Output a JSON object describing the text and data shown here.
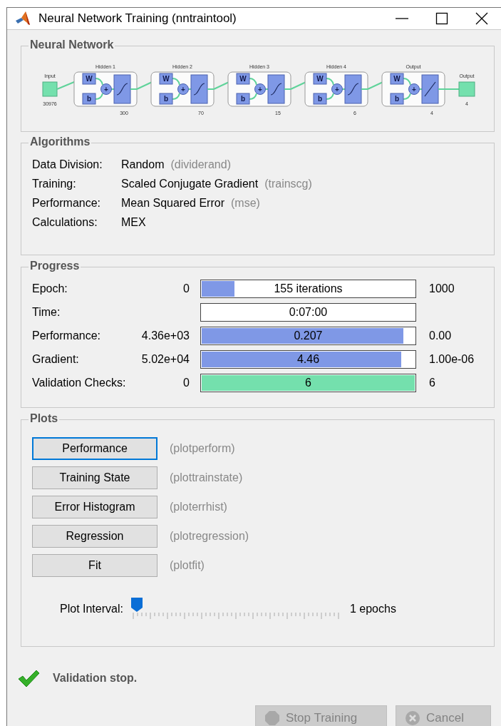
{
  "window": {
    "title": "Neural Network Training (nntraintool)"
  },
  "network": {
    "title": "Neural Network",
    "input": {
      "label": "Input",
      "size": "30976"
    },
    "layers": [
      {
        "label": "Hidden 1",
        "weight": "W",
        "bias": "b",
        "sum": "+",
        "kind": "sigmoid",
        "size": "300"
      },
      {
        "label": "Hidden 2",
        "weight": "W",
        "bias": "b",
        "sum": "+",
        "kind": "sigmoid",
        "size": "70"
      },
      {
        "label": "Hidden 3",
        "weight": "W",
        "bias": "b",
        "sum": "+",
        "kind": "sigmoid",
        "size": "15"
      },
      {
        "label": "Hidden 4",
        "weight": "W",
        "bias": "b",
        "sum": "+",
        "kind": "sigmoid",
        "size": "6"
      },
      {
        "label": "Output",
        "weight": "W",
        "bias": "b",
        "sum": "+",
        "kind": "linear",
        "size": "4"
      }
    ],
    "output": {
      "label": "Output",
      "size": "4"
    }
  },
  "algorithms": {
    "title": "Algorithms",
    "rows": [
      {
        "label": "Data Division:",
        "value": "Random",
        "function": "(dividerand)"
      },
      {
        "label": "Training:",
        "value": "Scaled Conjugate Gradient",
        "function": "(trainscg)"
      },
      {
        "label": "Performance:",
        "value": "Mean Squared Error",
        "function": "(mse)"
      },
      {
        "label": "Calculations:",
        "value": "MEX"
      }
    ]
  },
  "progress": {
    "title": "Progress",
    "rows": [
      {
        "label": "Epoch:",
        "start": "0",
        "reading": "155 iterations",
        "level": 0.155,
        "color": "#7f98e6",
        "end": "1000"
      },
      {
        "label": "Time:",
        "reading": "0:07:00"
      },
      {
        "label": "Performance:",
        "start": "4.36e+03",
        "reading": "0.207",
        "level": 0.948,
        "color": "#7f98e6",
        "end": "0.00"
      },
      {
        "label": "Gradient:",
        "start": "5.02e+04",
        "reading": "4.46",
        "level": 0.935,
        "color": "#7f98e6",
        "end": "1.00e-06"
      },
      {
        "label": "Validation Checks:",
        "start": "0",
        "reading": "6",
        "level": 1,
        "color": "#74e0ad",
        "end": "6"
      }
    ]
  },
  "plots": {
    "title": "Plots",
    "buttons": [
      {
        "label": "Performance",
        "function": "(plotperform)",
        "focused": true
      },
      {
        "label": "Training State",
        "function": "(plottrainstate)",
        "focused": false
      },
      {
        "label": "Error Histogram",
        "function": "(ploterrhist)",
        "focused": false
      },
      {
        "label": "Regression",
        "function": "(plotregression)",
        "focused": false
      },
      {
        "label": "Fit",
        "function": "(plotfit)",
        "focused": false
      }
    ],
    "interval": {
      "label": "Plot Interval:",
      "level": 0,
      "reading": "1 epochs"
    }
  },
  "status": {
    "kind": "success",
    "text": "Validation stop."
  },
  "actions": [
    {
      "kind": "stop",
      "label": "Stop Training",
      "disabled": true
    },
    {
      "kind": "cancel",
      "label": "Cancel",
      "disabled": true
    }
  ]
}
